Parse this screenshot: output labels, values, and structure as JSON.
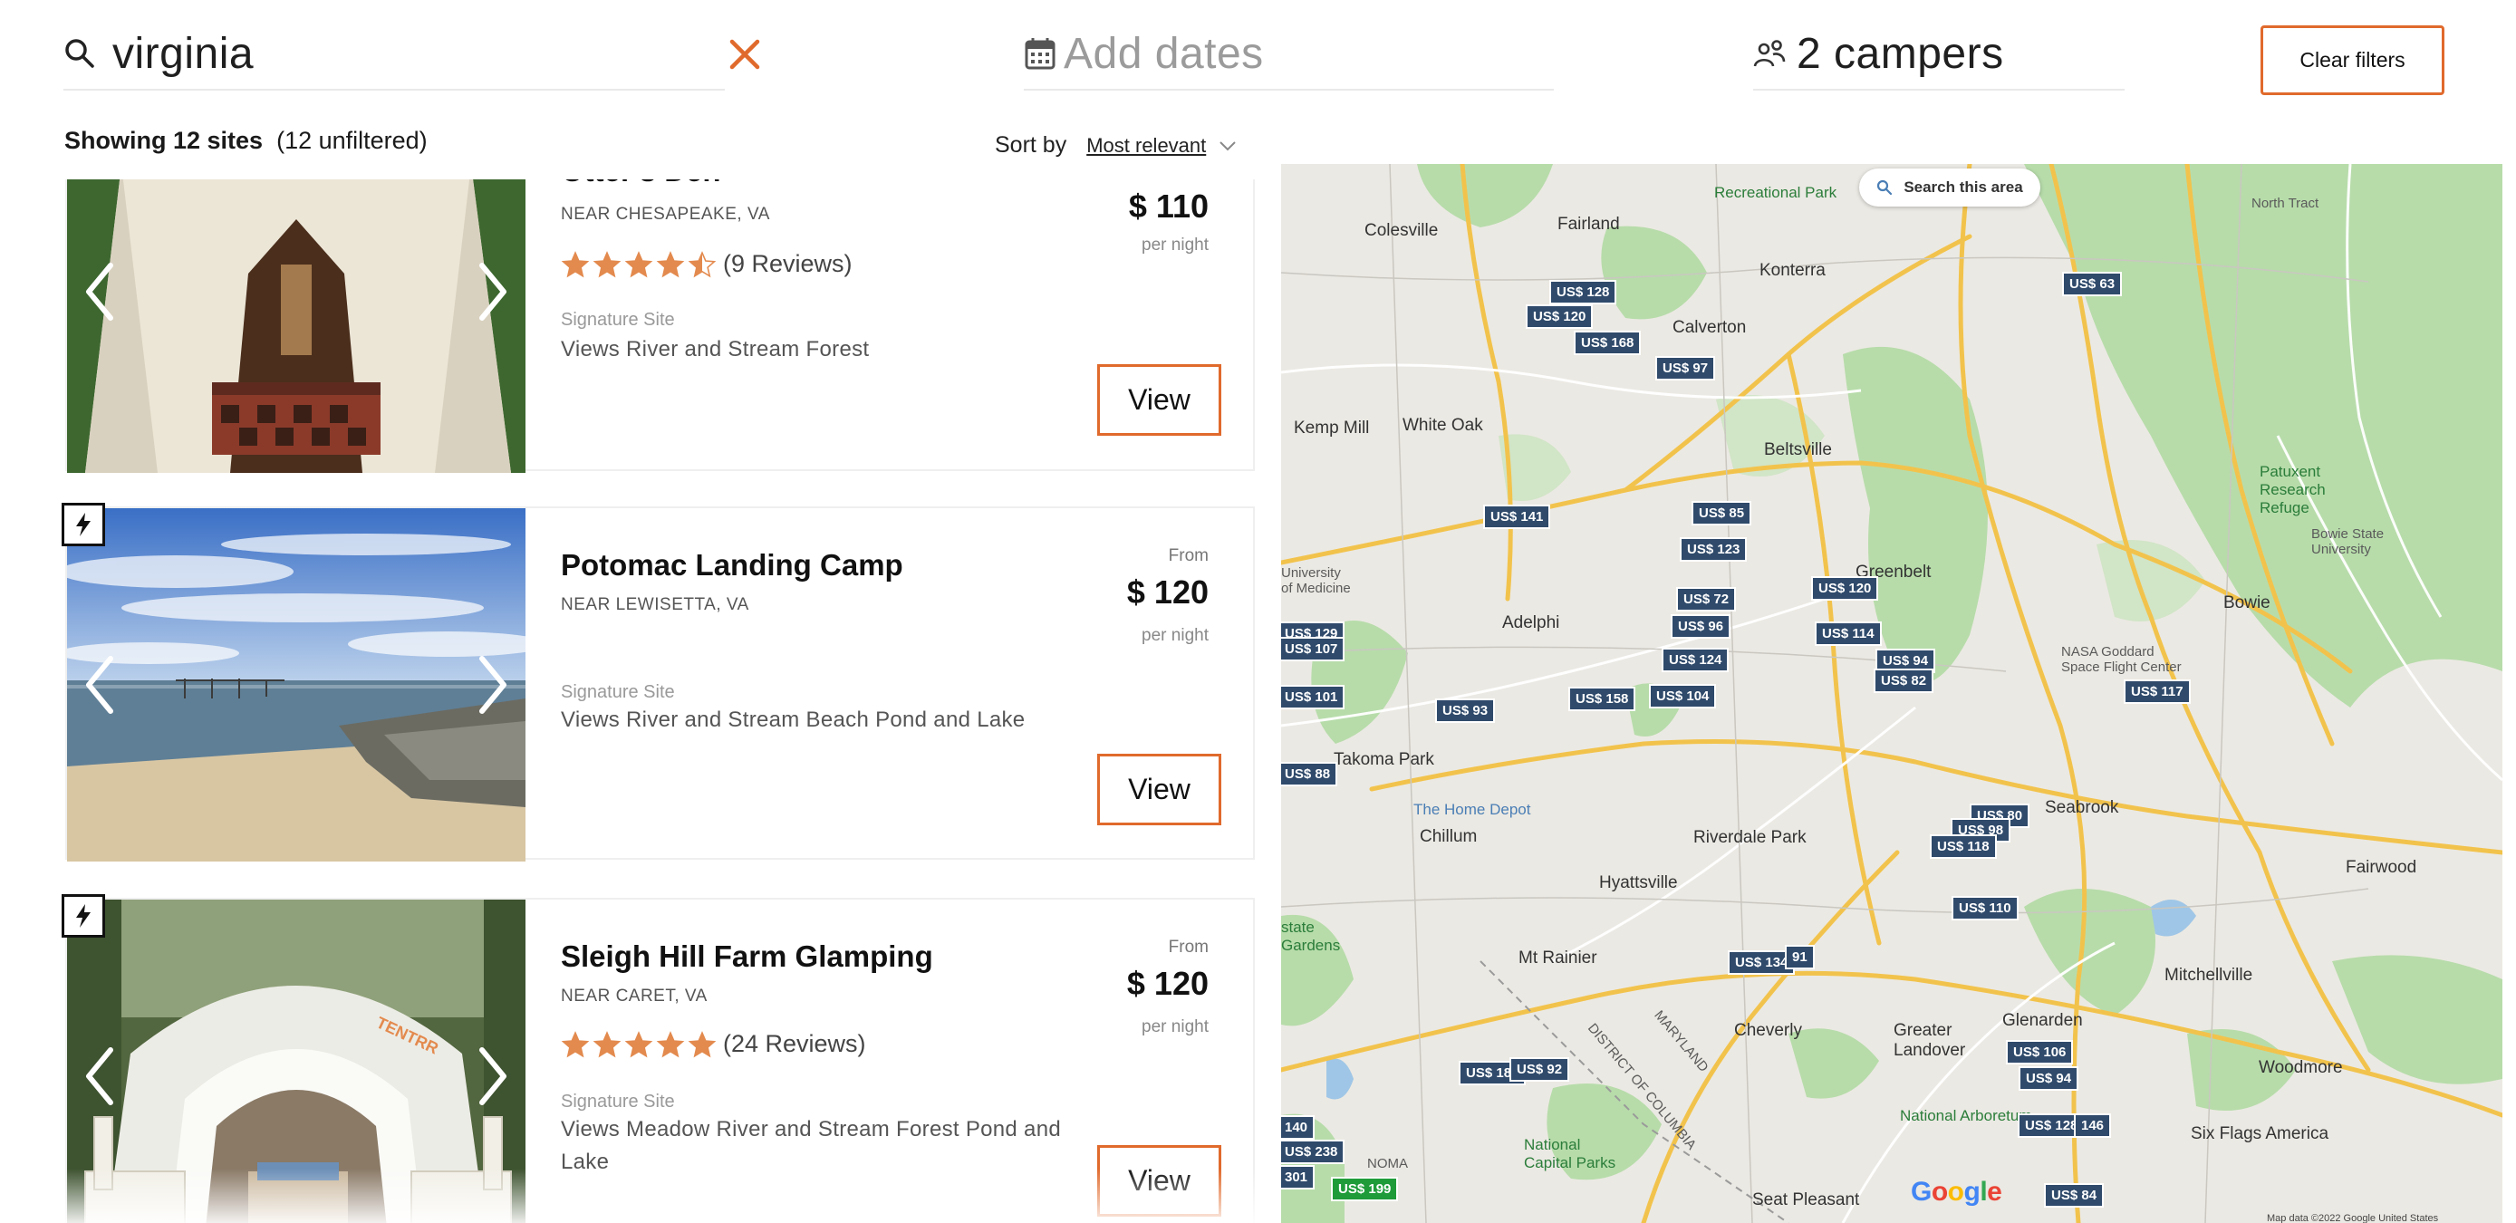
{
  "search": {
    "query": "virginia",
    "icon": "search-icon",
    "clear_icon": "close-icon"
  },
  "dates": {
    "placeholder": "Add dates",
    "icon": "calendar-icon"
  },
  "campers": {
    "label": "2 campers",
    "icon": "people-icon"
  },
  "clear_filters": "Clear filters",
  "results": {
    "showing_bold": "Showing 12 sites",
    "unfiltered": "(12 unfiltered)"
  },
  "sort": {
    "label": "Sort by",
    "selected": "Most relevant"
  },
  "listings": [
    {
      "title": "Otter's Den",
      "location": "NEAR CHESAPEAKE, VA",
      "rating": 4.5,
      "reviews": "(9 Reviews)",
      "tier": "Signature Site",
      "views": "Views River and Stream Forest",
      "from": "",
      "price": "$ 110",
      "per": "per night",
      "button": "View",
      "electric": false
    },
    {
      "title": "Potomac Landing Camp",
      "location": "NEAR LEWISETTA, VA",
      "rating": null,
      "reviews": "",
      "tier": "Signature Site",
      "views": "Views River and Stream Beach Pond and Lake",
      "from": "From",
      "price": "$ 120",
      "per": "per night",
      "button": "View",
      "electric": true
    },
    {
      "title": "Sleigh Hill Farm Glamping",
      "location": "NEAR CARET, VA",
      "rating": 5,
      "reviews": "(24 Reviews)",
      "tier": "Signature Site",
      "views": "Views Meadow River and Stream Forest Pond and Lake",
      "from": "From",
      "price": "$ 120",
      "per": "per night",
      "button": "View",
      "electric": true
    }
  ],
  "map": {
    "search_area": "Search this area",
    "google": "Google",
    "attribution": "Map data ©2022 Google    United States",
    "pins": [
      "US$ 128",
      "US$ 120",
      "US$ 168",
      "US$ 97",
      "US$ 63",
      "US$ 141",
      "US$ 85",
      "US$ 123",
      "US$ 120",
      "US$ 72",
      "US$ 96",
      "US$ 114",
      "US$ 129",
      "US$ 107",
      "US$ 124",
      "US$ 94",
      "US$ 82",
      "US$ 117",
      "US$ 101",
      "US$ 158",
      "US$ 104",
      "US$ 93",
      "US$ 88",
      "US$ 80",
      "US$ 98",
      "US$ 118",
      "US$ 110",
      "US$ 134",
      "91",
      "US$ 106",
      "US$ 94",
      "US$ 188",
      "US$ 92",
      "US$ 128",
      "146",
      "140",
      "US$ 238",
      "301",
      "US$ 199",
      "US$ 84"
    ],
    "places": [
      "Fairland",
      "Colesville",
      "Konterra",
      "North Tract",
      "Calverton",
      "Kemp Mill",
      "White Oak",
      "Beltsville",
      "Patuxent Research Refuge",
      "Bowie State University",
      "Adelphi",
      "Greenbelt",
      "Bowie",
      "NASA Goddard Space Flight Center",
      "Takoma Park",
      "Seabrook",
      "The Home Depot",
      "Chillum",
      "Riverdale Park",
      "Hyattsville",
      "Fairwood",
      "Mt Rainier",
      "Cheverly",
      "Greater Landover",
      "Glenarden",
      "Mitchellville",
      "Woodmore",
      "National Arboretum",
      "Six Flags America",
      "National Capital Parks",
      "Seat Pleasant",
      "MARYLAND",
      "DISTRICT OF COLUMBIA",
      "Recreational Park",
      "University of Medicine",
      "state Gardens",
      "NOMA"
    ]
  },
  "colors": {
    "accent": "#e06a2c",
    "pin": "#2f4a6b",
    "pin_green": "#1f9b3a",
    "star": "#e38a4e"
  }
}
